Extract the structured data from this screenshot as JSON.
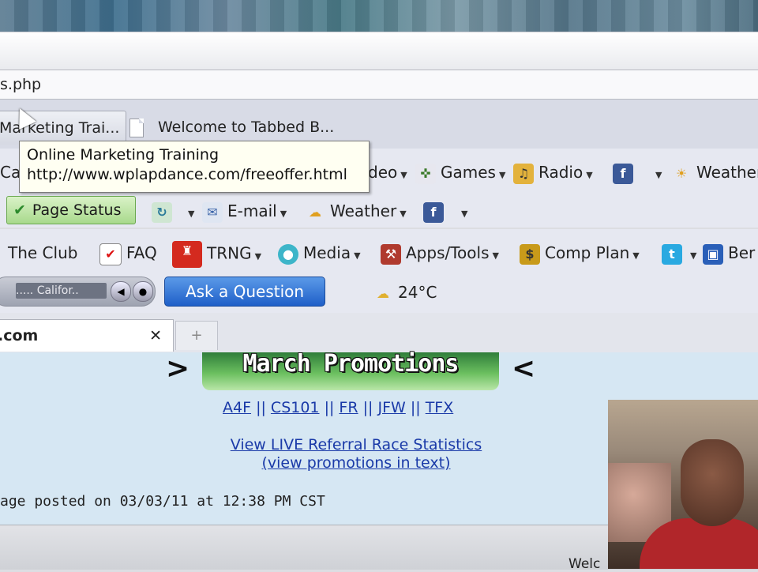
{
  "address_bar": {
    "url_fragment": "s.php"
  },
  "browser_tabs": [
    {
      "label": "Marketing Trai..."
    },
    {
      "label": "Welcome to Tabbed B..."
    }
  ],
  "tooltip": {
    "title": "Online Marketing Training",
    "url": "http://www.wplapdance.com/freeoffer.html"
  },
  "toolbar_row1": {
    "ca_fragment": "Ca",
    "video_fragment": "deo",
    "games": "Games",
    "radio": "Radio",
    "weather": "Weather"
  },
  "toolbar_row2": {
    "page_status": "Page Status",
    "email": "E-mail",
    "weather": "Weather"
  },
  "toolbar_row3": {
    "the_club": "The Club",
    "faq": "FAQ",
    "trng": "TRNG",
    "media": "Media",
    "apps_tools": "Apps/Tools",
    "comp_plan": "Comp Plan",
    "ben_fragment": "Ber"
  },
  "toolbar_row4": {
    "radio_display": ".....  Califor..",
    "ask_button": "Ask a Question",
    "temperature": "24°C"
  },
  "page_tab": {
    "label": ".com",
    "close": "✕",
    "new_tab": "+"
  },
  "content": {
    "banner": "March Promotions",
    "chevron_left": ">",
    "chevron_right": "<",
    "promo_links": [
      "A4F",
      "CS101",
      "FR",
      "JFW",
      "TFX"
    ],
    "separator": "||",
    "stats_link": "View LIVE Referral Race Statistics",
    "text_link": "(view promotions in text)",
    "posted": "age posted on 03/03/11 at 12:38 PM CST"
  },
  "status_bar": {
    "text": "Welc"
  },
  "colors": {
    "accent_blue": "#1f5fc8",
    "link": "#1a3aa8",
    "content_bg": "#d6e7f3",
    "facebook": "#3b5998"
  }
}
